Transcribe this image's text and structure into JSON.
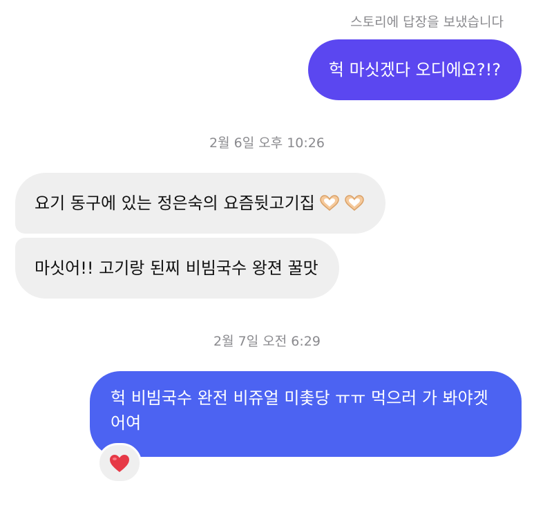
{
  "story_note": "스토리에 답장을 보냈습니다",
  "messages": {
    "sent1": "헉 마싯겠다 오디에요?!?",
    "timestamp1": "2월 6일 오후 10:26",
    "recv1_text": "요기 동구에 있는 정은숙의 요즘뒷고기집",
    "recv1_emoji": "heart-hands-emoji",
    "recv2": "마싯어!! 고기랑 된찌 비빔국수 왕젼 꿀맛",
    "timestamp2": "2월 7일 오전 6:29",
    "sent2": "헉 비빔국수 완전 비쥬얼 미촟당 ㅠㅠ 먹으러 가 봐야겟어여"
  },
  "reaction": {
    "icon": "heart-icon",
    "color": "#e63946"
  },
  "colors": {
    "sent_bubble_top": "#5b47f0",
    "sent_bubble_bottom": "#4c63f2",
    "received_bubble": "#efefef"
  }
}
